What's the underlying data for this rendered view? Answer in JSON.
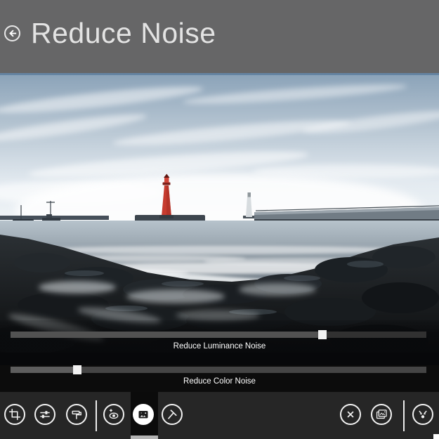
{
  "header": {
    "title": "Reduce Noise",
    "back_icon": "back-arrow-icon"
  },
  "photo": {
    "alt": "Harbor scene with a red lighthouse, a white lighthouse, breakwater pier and dark rocky shore"
  },
  "sliders": [
    {
      "label": "Reduce Luminance Noise",
      "value_pct": 75
    },
    {
      "label": "Reduce Color Noise",
      "value_pct": 16
    }
  ],
  "toolbar": {
    "left_buttons": [
      {
        "name": "crop",
        "icon": "crop-icon",
        "selected": false
      },
      {
        "name": "adjustments",
        "icon": "sliders-icon",
        "selected": false
      },
      {
        "name": "paint-roller",
        "icon": "paint-roller-icon",
        "selected": false
      },
      {
        "name": "red-eye",
        "icon": "red-eye-icon",
        "selected": false
      },
      {
        "name": "reduce-noise",
        "icon": "photo-noise-icon",
        "selected": true
      },
      {
        "name": "razor",
        "icon": "razor-icon",
        "selected": false
      }
    ],
    "right_buttons": [
      {
        "name": "cancel",
        "icon": "cancel-x-icon",
        "selected": false
      },
      {
        "name": "photo-stack",
        "icon": "photo-stack-icon",
        "selected": false
      },
      {
        "name": "share-merge",
        "icon": "merge-arrows-icon",
        "selected": false
      }
    ]
  },
  "colors": {
    "header_bg": "#666667",
    "appbar_bg": "#262626",
    "selected_column_bg": "#0b0b0b",
    "selected_underline": "#b3b3b3",
    "slider_thumb": "#f2f2f2",
    "lighthouse_red": "#c63b2f"
  }
}
